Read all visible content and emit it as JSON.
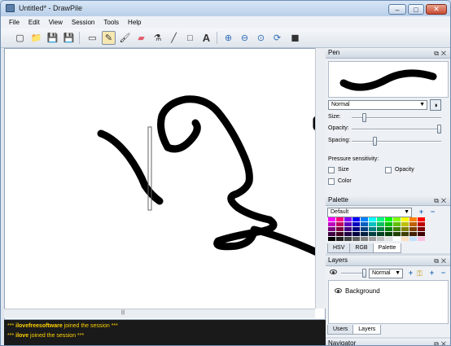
{
  "window": {
    "title": "Untitled* - DrawPile",
    "minimize": "–",
    "maximize": "□",
    "close": "✕"
  },
  "menu": [
    {
      "label": "File"
    },
    {
      "label": "Edit"
    },
    {
      "label": "View"
    },
    {
      "label": "Session"
    },
    {
      "label": "Tools"
    },
    {
      "label": "Help"
    }
  ],
  "toolbar": [
    {
      "name": "new-icon",
      "glyph": "▢"
    },
    {
      "name": "open-icon",
      "glyph": "📁"
    },
    {
      "name": "save-icon",
      "glyph": "💾"
    },
    {
      "name": "save-as-icon",
      "glyph": "💾"
    },
    {
      "name": "selection-icon",
      "glyph": "▭"
    },
    {
      "name": "pen-icon",
      "glyph": "✎",
      "active": true
    },
    {
      "name": "brush-icon",
      "glyph": "🖌"
    },
    {
      "name": "eraser-icon",
      "glyph": "▰"
    },
    {
      "name": "color-picker-icon",
      "glyph": "⚗"
    },
    {
      "name": "line-icon",
      "glyph": "╱"
    },
    {
      "name": "rectangle-icon",
      "glyph": "□"
    },
    {
      "name": "text-icon",
      "glyph": "A"
    },
    {
      "name": "zoom-in-icon",
      "glyph": "⊕"
    },
    {
      "name": "zoom-out-icon",
      "glyph": "⊖"
    },
    {
      "name": "zoom-reset-icon",
      "glyph": "⊙"
    },
    {
      "name": "rotate-icon",
      "glyph": "⟳"
    },
    {
      "name": "color-swatch-icon",
      "glyph": "■"
    }
  ],
  "chat": [
    {
      "prefix": "***",
      "user": "ilovefreesoftware",
      "text": "joined the session",
      "suffix": "***"
    },
    {
      "prefix": "***",
      "user": "ilove",
      "text": "joined the session",
      "suffix": "***"
    }
  ],
  "pen_panel": {
    "title": "Pen",
    "blend_mode": "Normal",
    "size_label": "Size:",
    "opacity_label": "Opacity:",
    "spacing_label": "Spacing:",
    "pressure_label": "Pressure sensitivity:",
    "pressure_size": "Size",
    "pressure_opacity": "Opacity",
    "pressure_color": "Color",
    "size_value": 0.12,
    "opacity_value": 1.0,
    "spacing_value": 0.25
  },
  "palette_panel": {
    "title": "Palette",
    "selected": "Default",
    "tabs": [
      "HSV",
      "RGB",
      "Palette"
    ],
    "active_tab": "Palette",
    "colors": [
      "#ff00ff",
      "#ff0080",
      "#8000ff",
      "#0000ff",
      "#0080ff",
      "#00ffff",
      "#00ff80",
      "#00ff00",
      "#80ff00",
      "#ffff00",
      "#ff8000",
      "#ff0000",
      "#c000c0",
      "#c00060",
      "#6000c0",
      "#0000c0",
      "#0060c0",
      "#00c0c0",
      "#00c060",
      "#00c000",
      "#60c000",
      "#c0c000",
      "#c06000",
      "#c00000",
      "#800080",
      "#800040",
      "#400080",
      "#000080",
      "#004080",
      "#008080",
      "#008040",
      "#008000",
      "#408000",
      "#808000",
      "#804000",
      "#800000",
      "#400040",
      "#400020",
      "#200040",
      "#000040",
      "#002040",
      "#004040",
      "#004020",
      "#004000",
      "#204000",
      "#404000",
      "#402000",
      "#400000",
      "#000000",
      "#202020",
      "#404040",
      "#606060",
      "#808080",
      "#a0a0a0",
      "#c0c0c0",
      "#e0e0e0",
      "#ffffff",
      "#ffe0c0",
      "#c0e0ff",
      "#ffc0e0"
    ]
  },
  "layers_panel": {
    "title": "Layers",
    "blend_mode": "Normal",
    "layers": [
      {
        "name": "Background"
      }
    ],
    "tabs": [
      "Users",
      "Layers"
    ],
    "active_tab": "Layers"
  },
  "navigator_panel": {
    "title": "Navigator"
  },
  "accent": "#ffd200"
}
